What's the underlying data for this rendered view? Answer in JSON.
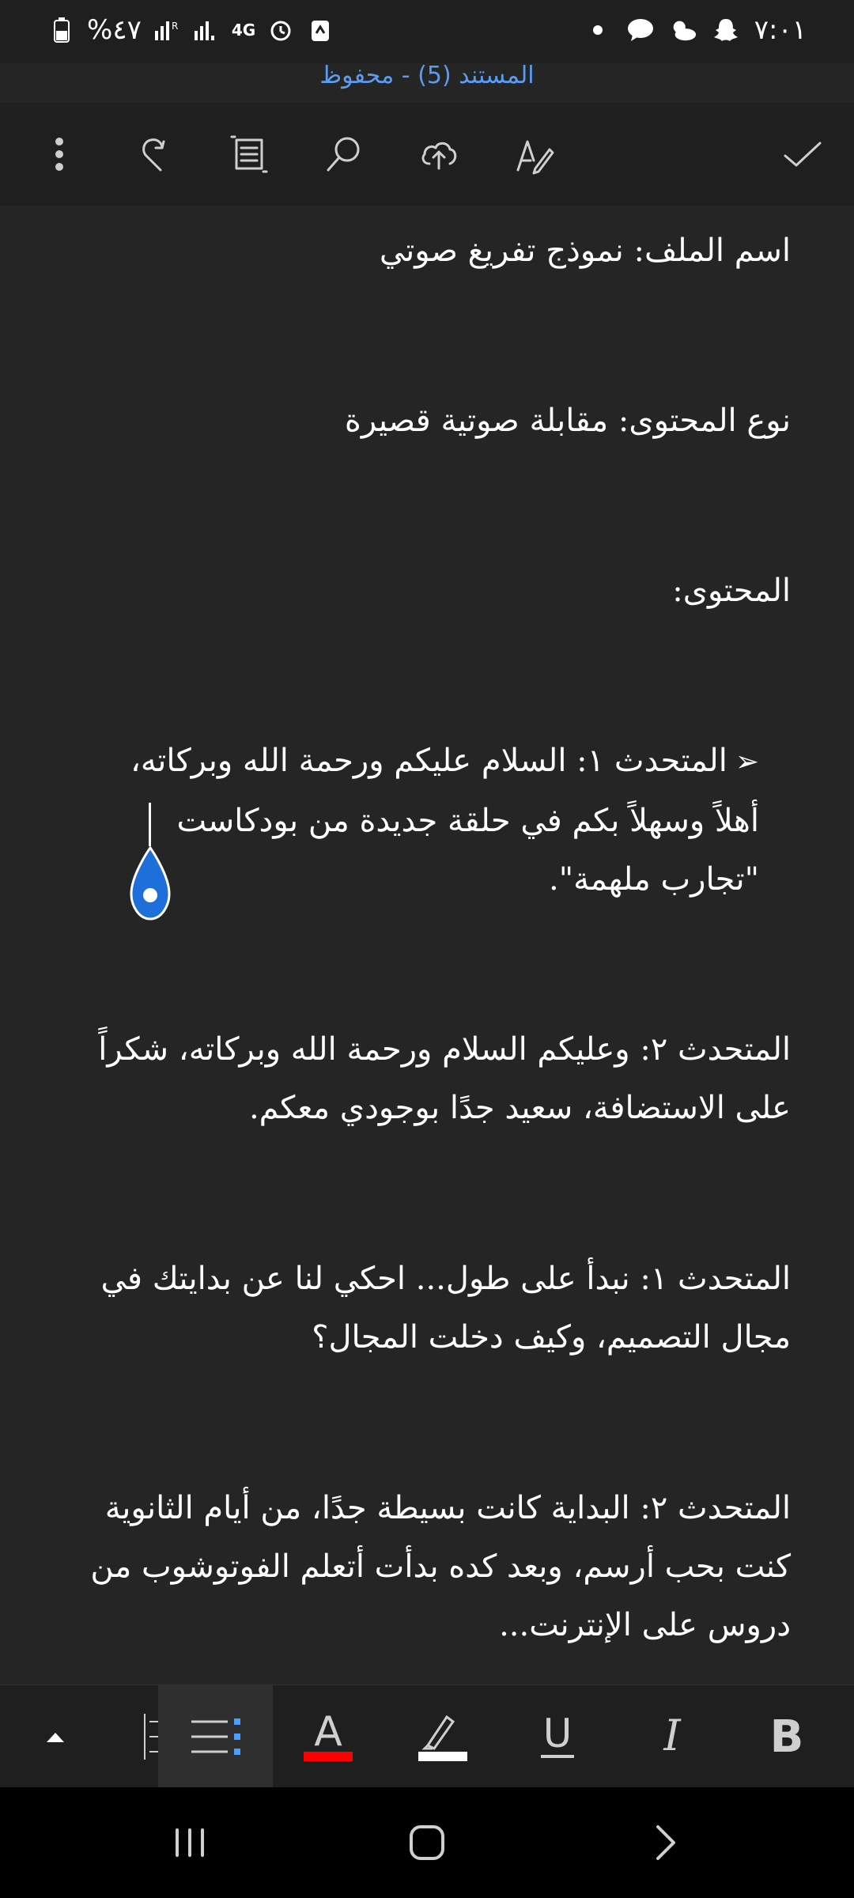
{
  "status_bar": {
    "time": "٧:٠١",
    "battery_percent": "%٤٧",
    "network": "4G"
  },
  "document": {
    "title": "المستند (5) - محفوظ",
    "lines": [
      "اسم الملف: نموذج تفريغ صوتي",
      "نوع المحتوى: مقابلة صوتية قصيرة",
      "المحتوى:",
      "المتحدث ١: السلام عليكم ورحمة الله وبركاته، أهلاً وسهلاً بكم في حلقة جديدة من بودكاست \"تجارب ملهمة\".",
      "المتحدث ٢: وعليكم السلام ورحمة الله وبركاته، شكراً على الاستضافة، سعيد جدًا بوجودي معكم.",
      "المتحدث ١: نبدأ على طول... احكي لنا عن بدايتك في مجال التصميم، وكيف دخلت المجال؟",
      "المتحدث ٢: البداية كانت بسيطة جدًا، من أيام الثانوية كنت بحب أرسم، وبعد كده بدأت أتعلم الفوتوشوب من دروس على الإنترنت..."
    ]
  },
  "toolbar": {
    "icons": [
      "more-icon",
      "redo-icon",
      "reading-view-icon",
      "search-icon",
      "upload-icon",
      "draw-icon",
      "check-icon"
    ]
  },
  "format_bar": {
    "bold_label": "B",
    "italic_label": "I",
    "underline_label": "U",
    "font_color_label": "A",
    "font_color": "#ff0000",
    "highlight_color": "#ffffff"
  },
  "colors": {
    "accent": "#5b9bf0",
    "background": "#252525",
    "cursor_handle": "#1e6fd9"
  }
}
